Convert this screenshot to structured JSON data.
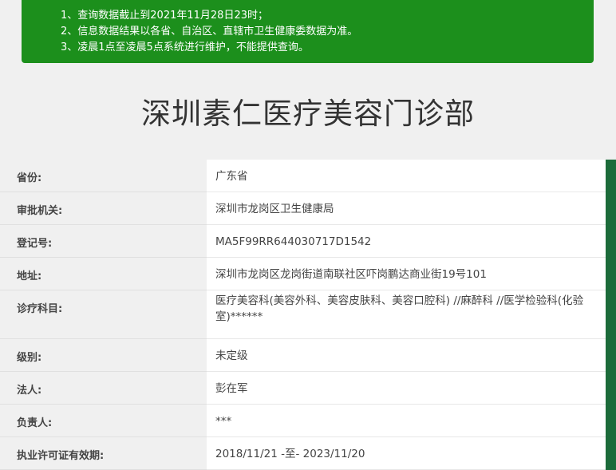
{
  "notice": {
    "lines": [
      "1、查询数据截止到2021年11月28日23时；",
      "2、信息数据结果以各省、自治区、直辖市卫生健康委数据为准。",
      "3、凌晨1点至凌晨5点系统进行维护，不能提供查询。"
    ]
  },
  "title": "深圳素仁医疗美容门诊部",
  "rows": [
    {
      "label": "省份:",
      "value": "广东省"
    },
    {
      "label": "审批机关:",
      "value": "深圳市龙岗区卫生健康局"
    },
    {
      "label": "登记号:",
      "value": "MA5F99RR644030717D1542"
    },
    {
      "label": "地址:",
      "value": "深圳市龙岗区龙岗街道南联社区吓岗鹏达商业街19号101"
    },
    {
      "label": "诊疗科目:",
      "value": "医疗美容科(美容外科、美容皮肤科、美容口腔科) //麻醉科 //医学检验科(化验室)******"
    },
    {
      "label": "级别:",
      "value": "未定级"
    },
    {
      "label": "法人:",
      "value": "彭在军"
    },
    {
      "label": "负责人:",
      "value": "***"
    },
    {
      "label": "执业许可证有效期:",
      "value": "2018/11/21 -至- 2023/11/20"
    }
  ],
  "colors": {
    "notice_bg": "#1c8f1c",
    "edge": "#1c6b3a"
  }
}
